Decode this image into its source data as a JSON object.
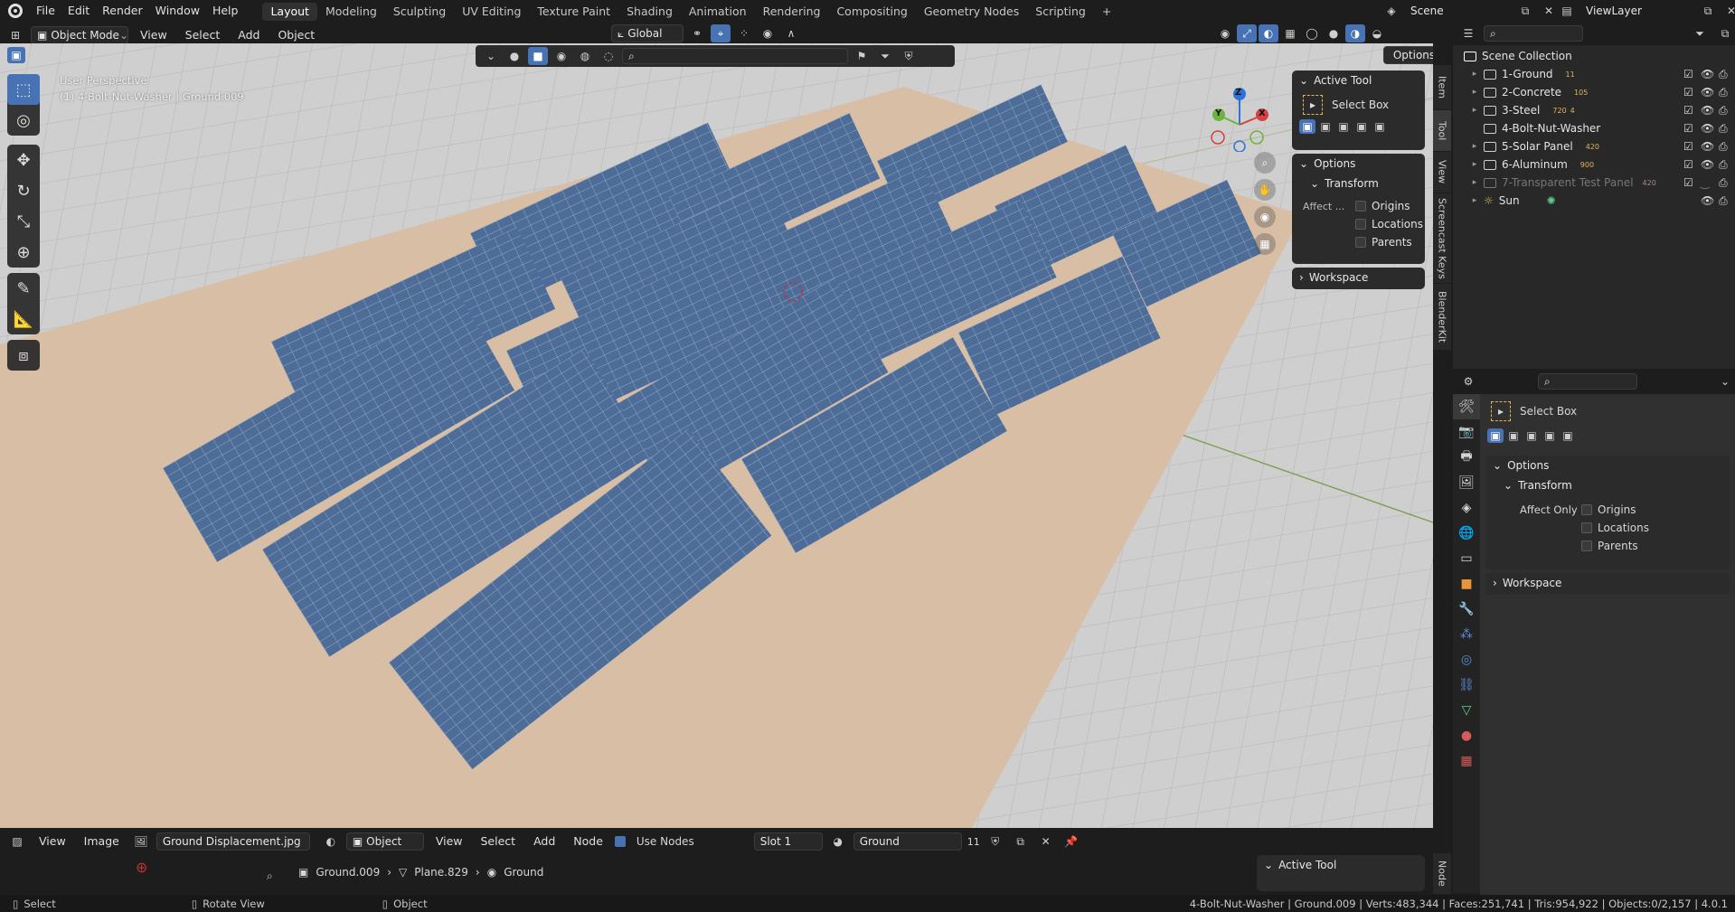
{
  "topbar": {
    "menus": [
      "File",
      "Edit",
      "Render",
      "Window",
      "Help"
    ],
    "workspaces": [
      "Layout",
      "Modeling",
      "Sculpting",
      "UV Editing",
      "Texture Paint",
      "Shading",
      "Animation",
      "Rendering",
      "Compositing",
      "Geometry Nodes",
      "Scripting"
    ],
    "active_workspace": "Layout",
    "add_tab": "+",
    "scene": "Scene",
    "view_layer": "ViewLayer"
  },
  "viewport_header": {
    "mode": "Object Mode",
    "menus": [
      "View",
      "Select",
      "Add",
      "Object"
    ],
    "transform_orientation": "Global",
    "options": "Options"
  },
  "viewport": {
    "perspective": "User Perspective",
    "object_info": "(1) 4-Bolt-Nut-Washer | Ground.009",
    "gizmo": {
      "x": "X",
      "y": "Y",
      "z": "Z"
    },
    "side_tabs": [
      "Item",
      "Tool",
      "View",
      "Screencast Keys",
      "BlenderKit"
    ]
  },
  "n_panel": {
    "active_tool_title": "Active Tool",
    "tool_name": "Select Box",
    "options_title": "Options",
    "transform_title": "Transform",
    "affect_label": "Affect ...",
    "affect_options": [
      {
        "label": "Origins",
        "checked": false
      },
      {
        "label": "Locations",
        "checked": false
      },
      {
        "label": "Parents",
        "checked": false
      }
    ],
    "workspace_title": "Workspace"
  },
  "outliner": {
    "root": "Scene Collection",
    "items": [
      {
        "name": "1-Ground",
        "badge": "11",
        "dim": false
      },
      {
        "name": "2-Concrete",
        "badge": "105",
        "dim": false
      },
      {
        "name": "3-Steel",
        "badge": "720",
        "badge2": "4",
        "dim": false
      },
      {
        "name": "4-Bolt-Nut-Washer",
        "badge": "",
        "dim": false
      },
      {
        "name": "5-Solar Panel",
        "badge": "420",
        "dim": false
      },
      {
        "name": "6-Aluminum",
        "badge": "900",
        "dim": false
      },
      {
        "name": "7-Transparent Test Panel",
        "badge": "420",
        "dim": true
      },
      {
        "name": "Sun",
        "badge": "",
        "dim": false
      }
    ]
  },
  "properties": {
    "tool_name": "Select Box",
    "options_title": "Options",
    "transform_title": "Transform",
    "affect_label": "Affect Only",
    "affect_options": [
      {
        "label": "Origins",
        "checked": false
      },
      {
        "label": "Locations",
        "checked": false
      },
      {
        "label": "Parents",
        "checked": false
      }
    ],
    "workspace_title": "Workspace"
  },
  "node_editor": {
    "menus": [
      "View",
      "Image"
    ],
    "image_name": "Ground Displacement.jpg",
    "shader_type": "Object",
    "menus2": [
      "View",
      "Select",
      "Add",
      "Node"
    ],
    "use_nodes": "Use Nodes",
    "slot": "Slot 1",
    "material": "Ground",
    "users": "11",
    "breadcrumb": [
      "Ground.009",
      "Plane.829",
      "Ground"
    ],
    "side_panel_title": "Active Tool",
    "side_tab": "Node"
  },
  "statusbar": {
    "hints": [
      "Select",
      "Rotate View",
      "Object"
    ],
    "stats": "4-Bolt-Nut-Washer | Ground.009 | Verts:483,344 | Faces:251,741 | Tris:954,922 | Objects:0/2,157 | 4.0.1"
  },
  "colors": {
    "accent": "#4772b3",
    "ground": "#d8bea5",
    "panel_blue": "#4a6c96",
    "grid_bg": "#c9c9c9"
  }
}
